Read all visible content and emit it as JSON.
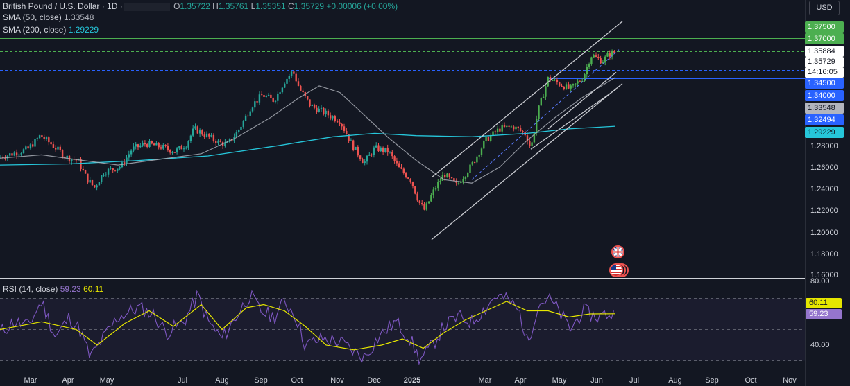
{
  "header": {
    "symbol_title": "British Pound / U.S. Dollar · 1D ·",
    "ohlc": {
      "o_key": "O",
      "o": "1.35722",
      "h_key": "H",
      "h": "1.35761",
      "l_key": "L",
      "l": "1.35351",
      "c_key": "C",
      "c": "1.35729",
      "change": "+0.00006 (+0.00%)"
    },
    "sma50": {
      "label": "SMA (50, close)",
      "value": "1.33548"
    },
    "sma200": {
      "label": "SMA (200, close)",
      "value": "1.29229"
    },
    "currency_button": "USD"
  },
  "price_axis": {
    "ticks": [
      "1.37500",
      "1.37000",
      "1.28000",
      "1.26000",
      "1.24000",
      "1.22000",
      "1.20000",
      "1.18000",
      "1.16000"
    ],
    "tags": {
      "high_line": "1.35884",
      "last": "1.35729",
      "countdown": "14:16:05",
      "level_a": "1.34500",
      "level_b": "1.34000",
      "sma50": "1.33548",
      "level_c": "1.32494",
      "sma200": "1.29229"
    }
  },
  "rsi": {
    "label": "RSI (14, close)",
    "value": "59.23",
    "ma_value": "60.11",
    "axis_ticks": [
      "80.00",
      "40.00"
    ]
  },
  "time_axis": [
    "Mar",
    "Apr",
    "May",
    "Jul",
    "Aug",
    "Sep",
    "Oct",
    "Nov",
    "Dec",
    "2025",
    "Mar",
    "Apr",
    "May",
    "Jun",
    "Jul",
    "Aug",
    "Sep",
    "Oct",
    "Nov"
  ],
  "colors": {
    "background": "#131722",
    "up": "#26a69a",
    "up_bright": "#4caf50",
    "down": "#ef5350",
    "sma50": "#b2b5be",
    "sma200": "#26c6da",
    "level_line": "#2962ff",
    "green_line": "#4caf50",
    "rsi": "#7e57c2",
    "rsi_ma": "#e6e600"
  },
  "chart_data": {
    "type": "candlestick",
    "title": "British Pound / U.S. Dollar · 1D",
    "ylim": [
      1.16,
      1.38
    ],
    "x": [
      "Mar",
      "Apr",
      "May",
      "Jul",
      "Aug",
      "Sep",
      "Oct",
      "Nov",
      "Dec",
      "2025",
      "Mar",
      "Apr",
      "May",
      "Jun",
      "Jul",
      "Aug",
      "Sep",
      "Oct",
      "Nov"
    ],
    "close_path": [
      [
        0,
        1.265
      ],
      [
        18,
        1.268
      ],
      [
        40,
        1.272
      ],
      [
        58,
        1.284
      ],
      [
        75,
        1.276
      ],
      [
        95,
        1.265
      ],
      [
        112,
        1.262
      ],
      [
        125,
        1.246
      ],
      [
        136,
        1.238
      ],
      [
        150,
        1.252
      ],
      [
        175,
        1.257
      ],
      [
        190,
        1.272
      ],
      [
        210,
        1.277
      ],
      [
        232,
        1.274
      ],
      [
        252,
        1.27
      ],
      [
        268,
        1.276
      ],
      [
        280,
        1.29
      ],
      [
        298,
        1.284
      ],
      [
        315,
        1.278
      ],
      [
        328,
        1.276
      ],
      [
        345,
        1.29
      ],
      [
        362,
        1.31
      ],
      [
        378,
        1.32
      ],
      [
        395,
        1.315
      ],
      [
        410,
        1.332
      ],
      [
        422,
        1.341
      ],
      [
        432,
        1.325
      ],
      [
        448,
        1.31
      ],
      [
        465,
        1.305
      ],
      [
        490,
        1.297
      ],
      [
        508,
        1.275
      ],
      [
        525,
        1.26
      ],
      [
        540,
        1.273
      ],
      [
        560,
        1.27
      ],
      [
        575,
        1.255
      ],
      [
        592,
        1.245
      ],
      [
        604,
        1.225
      ],
      [
        612,
        1.218
      ],
      [
        625,
        1.235
      ],
      [
        640,
        1.25
      ],
      [
        658,
        1.24
      ],
      [
        680,
        1.258
      ],
      [
        700,
        1.28
      ],
      [
        720,
        1.29
      ],
      [
        740,
        1.292
      ],
      [
        758,
        1.285
      ],
      [
        765,
        1.272
      ],
      [
        775,
        1.305
      ],
      [
        790,
        1.335
      ],
      [
        805,
        1.33
      ],
      [
        822,
        1.325
      ],
      [
        840,
        1.335
      ],
      [
        852,
        1.355
      ],
      [
        868,
        1.35
      ],
      [
        880,
        1.357
      ],
      [
        887,
        1.3573
      ]
    ],
    "sma50_path": [
      [
        0,
        1.264
      ],
      [
        60,
        1.267
      ],
      [
        120,
        1.262
      ],
      [
        170,
        1.258
      ],
      [
        230,
        1.263
      ],
      [
        290,
        1.268
      ],
      [
        340,
        1.282
      ],
      [
        390,
        1.3
      ],
      [
        430,
        1.317
      ],
      [
        460,
        1.328
      ],
      [
        490,
        1.322
      ],
      [
        520,
        1.305
      ],
      [
        560,
        1.282
      ],
      [
        600,
        1.262
      ],
      [
        640,
        1.245
      ],
      [
        680,
        1.242
      ],
      [
        720,
        1.256
      ],
      [
        760,
        1.28
      ],
      [
        800,
        1.3
      ],
      [
        840,
        1.318
      ],
      [
        887,
        1.3355
      ]
    ],
    "sma200_path": [
      [
        0,
        1.258
      ],
      [
        100,
        1.259
      ],
      [
        200,
        1.262
      ],
      [
        300,
        1.266
      ],
      [
        400,
        1.275
      ],
      [
        480,
        1.283
      ],
      [
        540,
        1.286
      ],
      [
        600,
        1.284
      ],
      [
        680,
        1.283
      ],
      [
        760,
        1.286
      ],
      [
        820,
        1.29
      ],
      [
        887,
        1.2923
      ]
    ],
    "channel_upper": [
      [
        622,
        1.247
      ],
      [
        897,
        1.385
      ]
    ],
    "channel_lower": [
      [
        622,
        1.192
      ],
      [
        897,
        1.33
      ]
    ],
    "channel_mid": [
      [
        680,
        1.245
      ],
      [
        892,
        1.36
      ]
    ],
    "inner_lines": [
      [
        [
          765,
          1.272
        ],
        [
          888,
          1.325
        ]
      ],
      [
        [
          790,
          1.29
        ],
        [
          888,
          1.34
        ]
      ]
    ],
    "horizontal_levels": [
      {
        "value": 1.37,
        "color": "green"
      },
      {
        "value": 1.35884,
        "color": "green-dashed"
      },
      {
        "value": 1.35729,
        "color": "green"
      },
      {
        "value": 1.345,
        "color": "blue",
        "x_start": 413
      },
      {
        "value": 1.342,
        "color": "blue-dashed"
      },
      {
        "value": 1.3345,
        "color": "blue",
        "x_start": 790
      }
    ],
    "rsi_series": {
      "name": "RSI (14, close)",
      "ylim": [
        30,
        80
      ],
      "path": [
        [
          0,
          48
        ],
        [
          20,
          55
        ],
        [
          40,
          52
        ],
        [
          60,
          68
        ],
        [
          80,
          45
        ],
        [
          100,
          58
        ],
        [
          115,
          50
        ],
        [
          130,
          32
        ],
        [
          145,
          42
        ],
        [
          170,
          58
        ],
        [
          200,
          64
        ],
        [
          220,
          60
        ],
        [
          240,
          48
        ],
        [
          265,
          55
        ],
        [
          285,
          72
        ],
        [
          300,
          55
        ],
        [
          320,
          44
        ],
        [
          340,
          58
        ],
        [
          360,
          72
        ],
        [
          375,
          62
        ],
        [
          395,
          58
        ],
        [
          410,
          68
        ],
        [
          425,
          60
        ],
        [
          440,
          40
        ],
        [
          465,
          44
        ],
        [
          490,
          42
        ],
        [
          510,
          36
        ],
        [
          525,
          32
        ],
        [
          545,
          45
        ],
        [
          570,
          55
        ],
        [
          590,
          45
        ],
        [
          605,
          30
        ],
        [
          620,
          38
        ],
        [
          640,
          52
        ],
        [
          660,
          58
        ],
        [
          680,
          55
        ],
        [
          700,
          64
        ],
        [
          715,
          72
        ],
        [
          735,
          68
        ],
        [
          750,
          60
        ],
        [
          760,
          40
        ],
        [
          775,
          66
        ],
        [
          790,
          70
        ],
        [
          805,
          62
        ],
        [
          822,
          50
        ],
        [
          840,
          62
        ],
        [
          860,
          58
        ],
        [
          875,
          60
        ],
        [
          887,
          59.23
        ]
      ],
      "ma_path": [
        [
          0,
          50
        ],
        [
          60,
          55
        ],
        [
          110,
          50
        ],
        [
          140,
          40
        ],
        [
          180,
          54
        ],
        [
          215,
          62
        ],
        [
          250,
          52
        ],
        [
          290,
          66
        ],
        [
          320,
          50
        ],
        [
          355,
          64
        ],
        [
          380,
          66
        ],
        [
          410,
          62
        ],
        [
          440,
          52
        ],
        [
          470,
          40
        ],
        [
          510,
          37
        ],
        [
          550,
          40
        ],
        [
          580,
          44
        ],
        [
          610,
          38
        ],
        [
          640,
          48
        ],
        [
          670,
          56
        ],
        [
          700,
          62
        ],
        [
          730,
          68
        ],
        [
          760,
          62
        ],
        [
          790,
          62
        ],
        [
          820,
          58
        ],
        [
          850,
          60
        ],
        [
          887,
          60.11
        ]
      ]
    }
  }
}
